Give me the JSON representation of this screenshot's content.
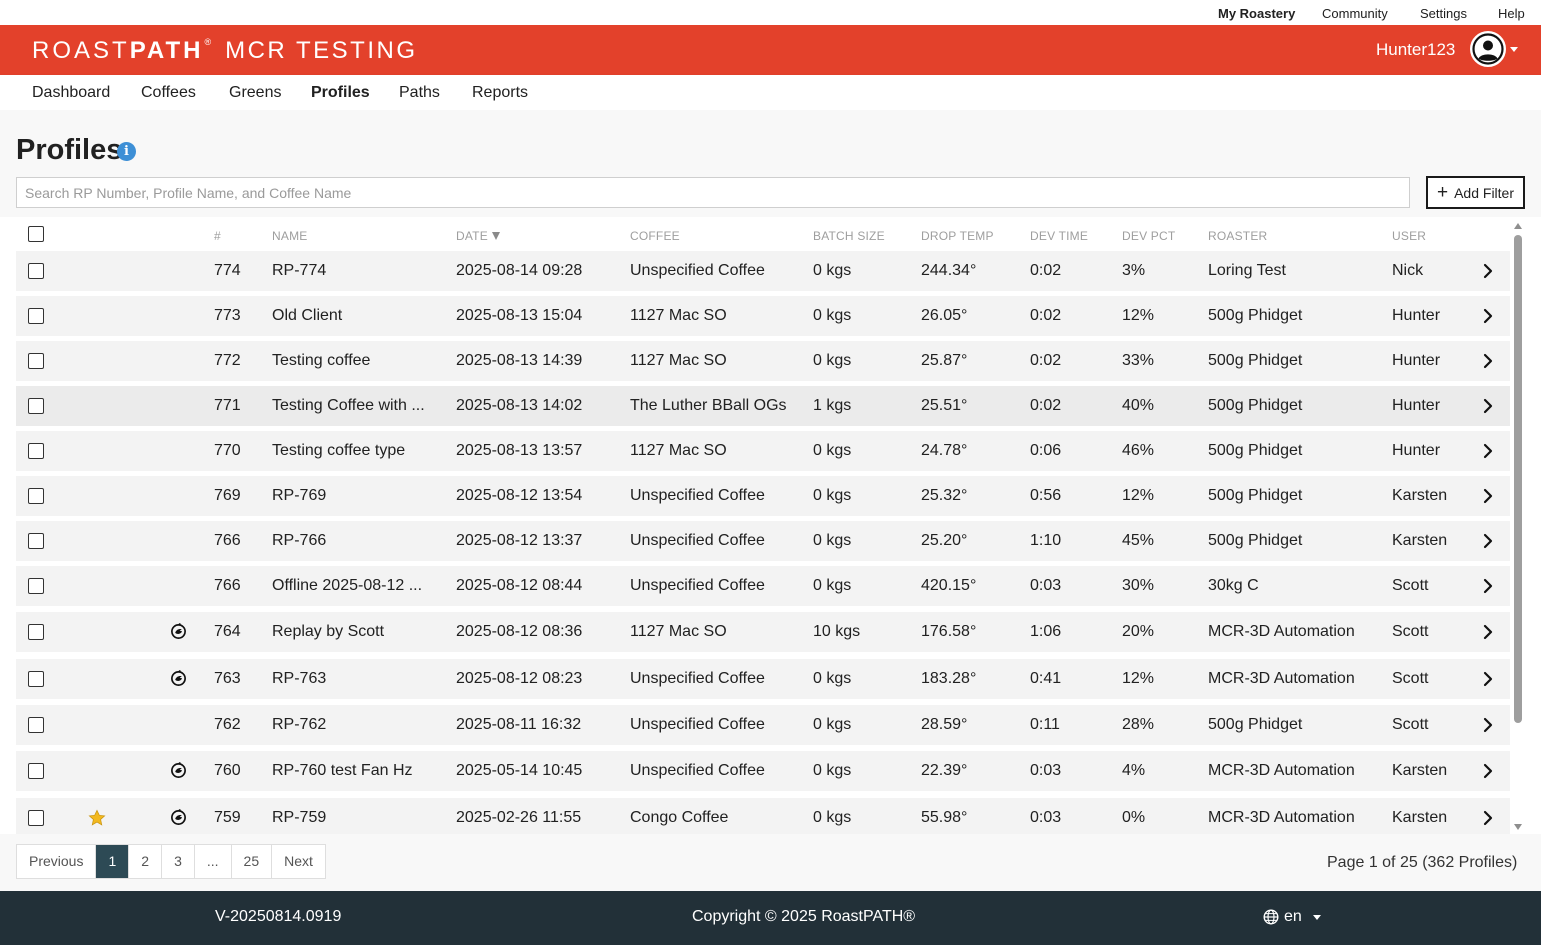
{
  "top_links": {
    "my_roastery": "My Roastery",
    "community": "Community",
    "settings": "Settings",
    "help": "Help"
  },
  "brand": {
    "part1": "ROAST",
    "part2": "PATH",
    "reg": "®",
    "account": "MCR TESTING"
  },
  "user": {
    "name": "Hunter123"
  },
  "nav": {
    "dashboard": "Dashboard",
    "coffees": "Coffees",
    "greens": "Greens",
    "profiles": "Profiles",
    "paths": "Paths",
    "reports": "Reports"
  },
  "page": {
    "title": "Profiles",
    "info_glyph": "i"
  },
  "search": {
    "placeholder": "Search RP Number, Profile Name, and Coffee Name",
    "value": ""
  },
  "add_filter": {
    "label": "Add Filter"
  },
  "table": {
    "columns": {
      "num": "#",
      "name": "NAME",
      "date": "DATE",
      "coffee": "COFFEE",
      "batch": "BATCH SIZE",
      "drop": "DROP TEMP",
      "devtime": "DEV TIME",
      "devpct": "DEV PCT",
      "roaster": "ROASTER",
      "user": "USER"
    },
    "rows": [
      {
        "num": "774",
        "name": "RP-774",
        "date": "2025-08-14 09:28",
        "coffee": "Unspecified Coffee",
        "batch": "0 kgs",
        "drop": "244.34°",
        "devtime": "0:02",
        "devpct": "3%",
        "roaster": "Loring Test",
        "user": "Nick",
        "auto": false,
        "star": false
      },
      {
        "num": "773",
        "name": "Old Client",
        "date": "2025-08-13 15:04",
        "coffee": "1127 Mac SO",
        "batch": "0 kgs",
        "drop": "26.05°",
        "devtime": "0:02",
        "devpct": "12%",
        "roaster": "500g Phidget",
        "user": "Hunter",
        "auto": false,
        "star": false
      },
      {
        "num": "772",
        "name": "Testing coffee",
        "date": "2025-08-13 14:39",
        "coffee": "1127 Mac SO",
        "batch": "0 kgs",
        "drop": "25.87°",
        "devtime": "0:02",
        "devpct": "33%",
        "roaster": "500g Phidget",
        "user": "Hunter",
        "auto": false,
        "star": false
      },
      {
        "num": "771",
        "name": "Testing Coffee with ...",
        "date": "2025-08-13 14:02",
        "coffee": "The Luther BBall OGs",
        "batch": "1 kgs",
        "drop": "25.51°",
        "devtime": "0:02",
        "devpct": "40%",
        "roaster": "500g Phidget",
        "user": "Hunter",
        "auto": false,
        "star": false
      },
      {
        "num": "770",
        "name": "Testing coffee type",
        "date": "2025-08-13 13:57",
        "coffee": "1127 Mac SO",
        "batch": "0 kgs",
        "drop": "24.78°",
        "devtime": "0:06",
        "devpct": "46%",
        "roaster": "500g Phidget",
        "user": "Hunter",
        "auto": false,
        "star": false
      },
      {
        "num": "769",
        "name": "RP-769",
        "date": "2025-08-12 13:54",
        "coffee": "Unspecified Coffee",
        "batch": "0 kgs",
        "drop": "25.32°",
        "devtime": "0:56",
        "devpct": "12%",
        "roaster": "500g Phidget",
        "user": "Karsten",
        "auto": false,
        "star": false
      },
      {
        "num": "766",
        "name": "RP-766",
        "date": "2025-08-12 13:37",
        "coffee": "Unspecified Coffee",
        "batch": "0 kgs",
        "drop": "25.20°",
        "devtime": "1:10",
        "devpct": "45%",
        "roaster": "500g Phidget",
        "user": "Karsten",
        "auto": false,
        "star": false
      },
      {
        "num": "766",
        "name": "Offline 2025-08-12 ...",
        "date": "2025-08-12 08:44",
        "coffee": "Unspecified Coffee",
        "batch": "0 kgs",
        "drop": "420.15°",
        "devtime": "0:03",
        "devpct": "30%",
        "roaster": "30kg C",
        "user": "Scott",
        "auto": false,
        "star": false
      },
      {
        "num": "764",
        "name": "Replay by Scott",
        "date": "2025-08-12 08:36",
        "coffee": "1127 Mac SO",
        "batch": "10 kgs",
        "drop": "176.58°",
        "devtime": "1:06",
        "devpct": "20%",
        "roaster": "MCR-3D Automation",
        "user": "Scott",
        "auto": true,
        "star": false
      },
      {
        "num": "763",
        "name": "RP-763",
        "date": "2025-08-12 08:23",
        "coffee": "Unspecified Coffee",
        "batch": "0 kgs",
        "drop": "183.28°",
        "devtime": "0:41",
        "devpct": "12%",
        "roaster": "MCR-3D Automation",
        "user": "Scott",
        "auto": true,
        "star": false
      },
      {
        "num": "762",
        "name": "RP-762",
        "date": "2025-08-11 16:32",
        "coffee": "Unspecified Coffee",
        "batch": "0 kgs",
        "drop": "28.59°",
        "devtime": "0:11",
        "devpct": "28%",
        "roaster": "500g Phidget",
        "user": "Scott",
        "auto": false,
        "star": false
      },
      {
        "num": "760",
        "name": "RP-760 test Fan Hz",
        "date": "2025-05-14 10:45",
        "coffee": "Unspecified Coffee",
        "batch": "0 kgs",
        "drop": "22.39°",
        "devtime": "0:03",
        "devpct": "4%",
        "roaster": "MCR-3D Automation",
        "user": "Karsten",
        "auto": true,
        "star": false
      },
      {
        "num": "759",
        "name": "RP-759",
        "date": "2025-02-26 11:55",
        "coffee": "Congo Coffee",
        "batch": "0 kgs",
        "drop": "55.98°",
        "devtime": "0:03",
        "devpct": "0%",
        "roaster": "MCR-3D Automation",
        "user": "Karsten",
        "auto": true,
        "star": true
      }
    ]
  },
  "pagination": {
    "previous": "Previous",
    "pages": [
      "1",
      "2",
      "3",
      "...",
      "25"
    ],
    "next": "Next",
    "info": "Page 1 of 25 (362 Profiles)",
    "current": 1
  },
  "footer": {
    "version": "V-20250814.0919",
    "copyright": "Copyright © 2025 RoastPATH®",
    "language": "en"
  },
  "colors": {
    "brand_red": "#e3412b",
    "footer_dark": "#223038",
    "page_active": "#2d4a55",
    "info_blue": "#3d8fd6",
    "star_gold": "#f2b81e"
  }
}
